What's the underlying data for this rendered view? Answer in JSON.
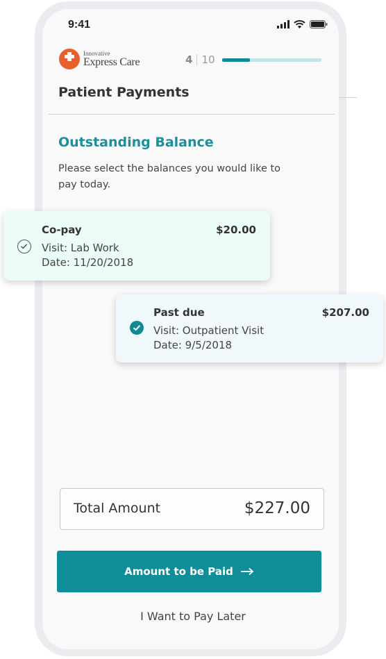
{
  "status_bar": {
    "time": "9:41"
  },
  "header": {
    "brand_small": "Innovative",
    "brand_name": "Express Care",
    "step_current": "4",
    "step_total": "10",
    "progress": 0.28,
    "page_title": "Patient Payments"
  },
  "main": {
    "section_heading": "Outstanding Balance",
    "instructions": "Please select the balances you would like to pay today."
  },
  "balances": [
    {
      "title": "Co-pay",
      "visit": "Visit: Lab Work",
      "date": "Date: 11/20/2018",
      "amount": "$20.00",
      "selected": false
    },
    {
      "title": "Past due",
      "visit": "Visit: Outpatient Visit",
      "date": "Date: 9/5/2018",
      "amount": "$207.00",
      "selected": true
    }
  ],
  "total": {
    "label": "Total Amount",
    "value": "$227.00"
  },
  "actions": {
    "pay_label": "Amount to be Paid",
    "pay_later_label": "I Want to Pay Later"
  },
  "colors": {
    "accent": "#0f8e9a",
    "brand_orange": "#e8612c",
    "copay_card_bg": "#ebfbf8",
    "pastdue_card_bg": "#f1f8fb"
  },
  "icons": {
    "check_unselected": "circle-check-outline-icon",
    "check_selected": "circle-check-filled-icon",
    "arrow": "arrow-right-icon"
  }
}
